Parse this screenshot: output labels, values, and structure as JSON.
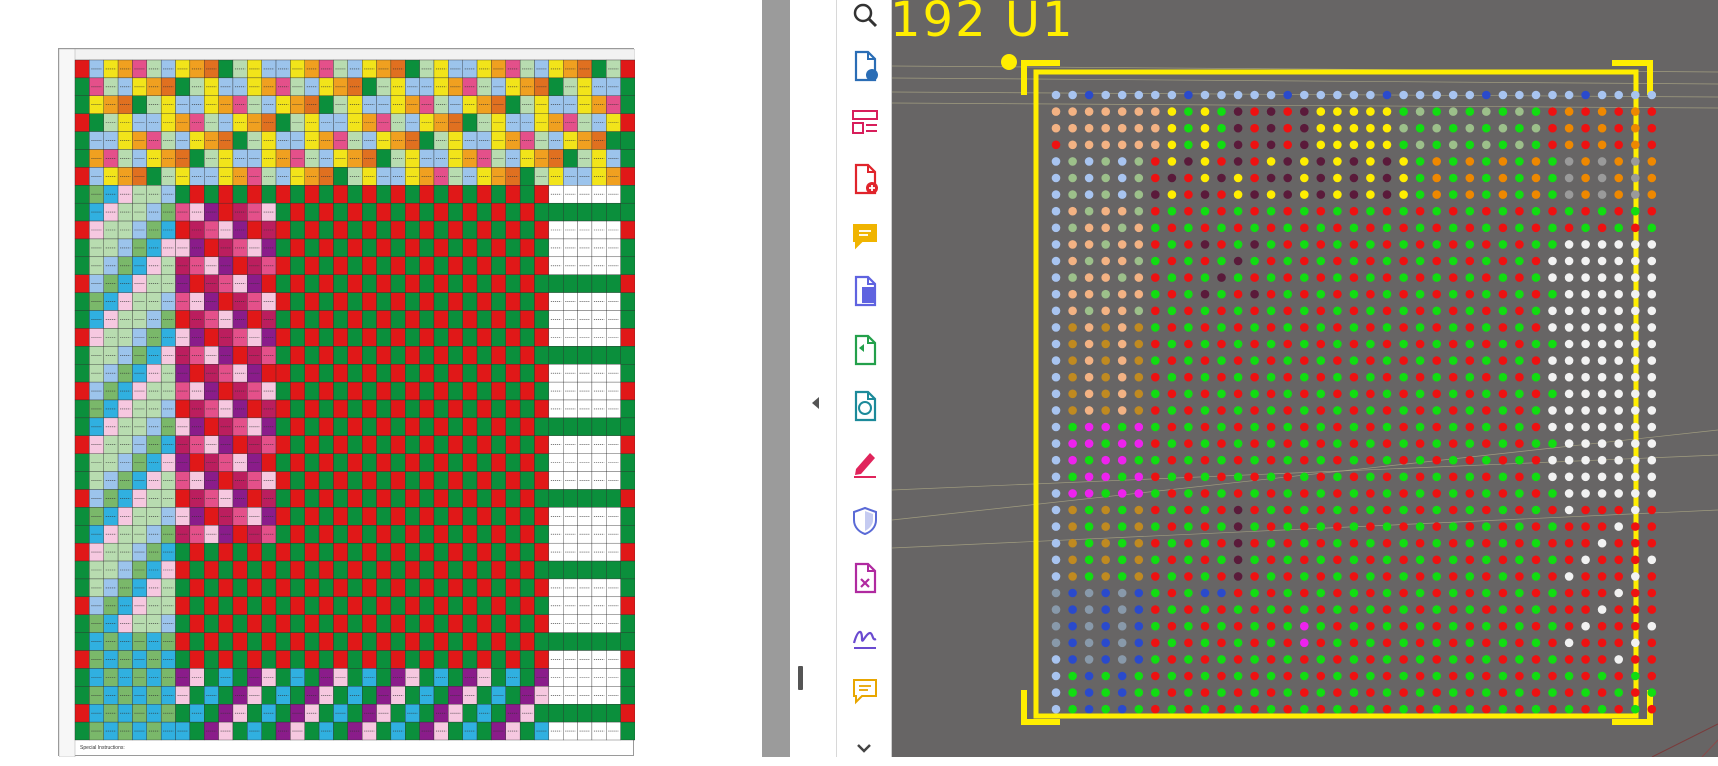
{
  "document": {
    "footer_text": "Special Instructions:"
  },
  "pcb_view": {
    "ref_label": "192 U1",
    "background_color": "#676565",
    "outline_color": "#ffee00",
    "pad_colors": {
      "green": "#11dd11",
      "red": "#ee1111",
      "white": "#f2f2f2",
      "light_blue": "#a8c4f0",
      "orange": "#ee8800",
      "yellow": "#ffee00",
      "peach": "#f3b283",
      "dark_purple": "#5a1a3a",
      "magenta": "#ee22ee",
      "sage": "#9cc08a",
      "ochre": "#c08a20",
      "slate": "#8899aa",
      "blue": "#2a4acc",
      "gray": "#9a9a9a"
    }
  },
  "toolbar": {
    "tools": [
      {
        "name": "zoom-icon",
        "color": "#333333"
      },
      {
        "name": "export-pdf-icon",
        "color": "#2a6db5"
      },
      {
        "name": "organize-pages-icon",
        "color": "#d81e5b"
      },
      {
        "name": "create-pdf-icon",
        "color": "#e0242b"
      },
      {
        "name": "comment-icon",
        "color": "#f0b400"
      },
      {
        "name": "combine-files-icon",
        "color": "#5f63e0"
      },
      {
        "name": "compress-pdf-icon",
        "color": "#23a04b"
      },
      {
        "name": "edit-pdf-icon",
        "color": "#1c8a9a"
      },
      {
        "name": "fill-sign-icon",
        "color": "#e0245b"
      },
      {
        "name": "protect-icon",
        "color": "#5a6ad6"
      },
      {
        "name": "redact-icon",
        "color": "#b02aa0"
      },
      {
        "name": "request-signature-icon",
        "color": "#6a4ad0"
      },
      {
        "name": "send-for-comments-icon",
        "color": "#e8a600"
      },
      {
        "name": "more-tools-icon",
        "color": "#444444"
      }
    ]
  },
  "sheet_palette": [
    "#0b8f3c",
    "#e01818",
    "#f2e41a",
    "#f0a020",
    "#e4508a",
    "#b8dcb0",
    "#9cc4ec",
    "#bb1e5e",
    "#8a1c8a",
    "#30b0e0",
    "#ffffff",
    "#f6c8e0",
    "#e07020",
    "#7ab86a"
  ]
}
